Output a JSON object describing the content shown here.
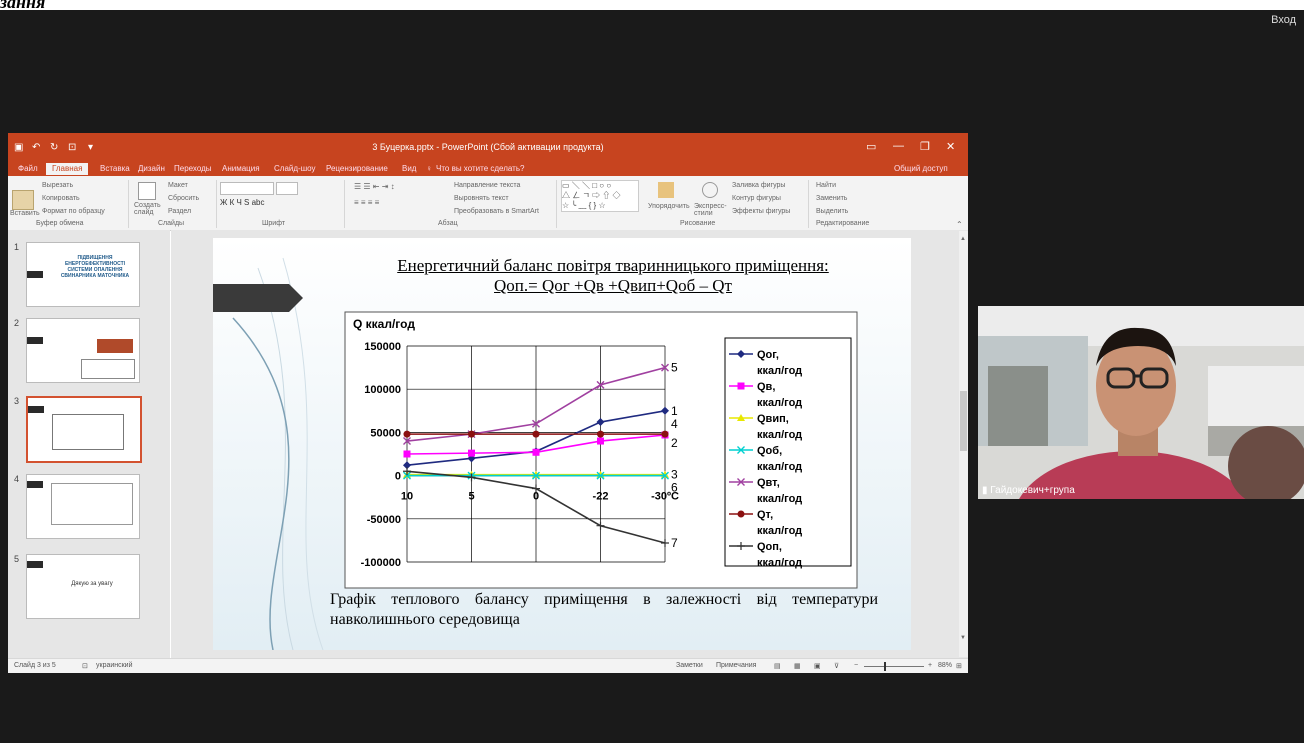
{
  "overlay": {
    "top_text": "зання",
    "login": "Вход"
  },
  "ppt": {
    "window_title": "3 Буцерка.pptx - PowerPoint (Сбой активации продукта)",
    "tabs": [
      "Файл",
      "Главная",
      "Вставка",
      "Дизайн",
      "Переходы",
      "Анимация",
      "Слайд-шоу",
      "Рецензирование",
      "Вид"
    ],
    "tell_me": "Что вы хотите сделать?",
    "share": "Общий доступ",
    "ribbon": {
      "paste": "Вставить",
      "cut": "Вырезать",
      "copy": "Копировать",
      "format_painter": "Формат по образцу",
      "clipboard": "Буфер обмена",
      "create_slide": "Создать слайд",
      "layout": "Макет",
      "reset": "Сбросить",
      "section": "Раздел",
      "slides": "Слайды",
      "font": "Шрифт",
      "paragraph": "Абзац",
      "text_direction": "Направление текста",
      "align_text": "Выровнять текст",
      "convert_smartart": "Преобразовать в SmartArt",
      "arrange": "Упорядочить",
      "quick_styles": "Экспресс-стили",
      "fill": "Заливка фигуры",
      "outline": "Контур фигуры",
      "effects": "Эффекты фигуры",
      "drawing": "Рисование",
      "find": "Найти",
      "replace": "Заменить",
      "select": "Выделить",
      "editing": "Редактирование"
    },
    "status": {
      "slide": "Слайд 3 из 5",
      "lang": "украинский",
      "notes": "Заметки",
      "comments": "Примечания",
      "zoom": "88%"
    }
  },
  "thumbnails": [
    {
      "num": "1",
      "title": "ПІДВИЩЕННЯ ЕНЕРГОЕФЕКТИВНОСТІ СИСТЕМИ ОПАЛЕННЯ СВИНАРНИКА МАТОЧНИКА",
      "selected": false
    },
    {
      "num": "2",
      "title": "",
      "selected": false
    },
    {
      "num": "3",
      "title": "",
      "selected": true
    },
    {
      "num": "4",
      "title": "",
      "selected": false
    },
    {
      "num": "5",
      "title": "Дякую за увагу",
      "selected": false
    }
  ],
  "slide": {
    "title_line1": "Енергетичний баланс повітря тваринницького приміщення:",
    "title_line2": "Qоп.= Qог +Qв +Qвип+Qоб – Qт",
    "caption": "Графік теплового балансу приміщення в залежності від температури навколишнього середовища"
  },
  "chart_data": {
    "type": "line",
    "ylabel": "Q ккал/год",
    "categories": [
      "10",
      "5",
      "0",
      "-22",
      "-30ºC"
    ],
    "ylim": [
      -100000,
      150000
    ],
    "yticks": [
      "150000",
      "100000",
      "50000",
      "0",
      "-50000",
      "-100000"
    ],
    "series": [
      {
        "name": "Qог, ккал/год",
        "values": [
          12000,
          20000,
          28000,
          62000,
          75000
        ],
        "color": "#1f2a80",
        "marker": "diamond",
        "label": "1"
      },
      {
        "name": "Qв, ккал/год",
        "values": [
          25000,
          26000,
          27000,
          40000,
          47000
        ],
        "color": "#ff00ff",
        "marker": "square",
        "label": "2"
      },
      {
        "name": "Qвип, ккал/год",
        "values": [
          1000,
          1000,
          1000,
          1000,
          1000
        ],
        "color": "#e8e800",
        "marker": "triangle",
        "label": "3"
      },
      {
        "name": "Qоб, ккал/год",
        "values": [
          0,
          0,
          0,
          0,
          0
        ],
        "color": "#00d0d0",
        "marker": "x",
        "label": "6"
      },
      {
        "name": "Qвт, ккал/год",
        "values": [
          40000,
          48000,
          60000,
          105000,
          125000
        ],
        "color": "#a040a0",
        "marker": "x",
        "label": "5"
      },
      {
        "name": "Qт, ккал/год",
        "values": [
          48000,
          48000,
          48000,
          48000,
          48000
        ],
        "color": "#8b1010",
        "marker": "circle",
        "label": "4"
      },
      {
        "name": "Qоп, ккал/год",
        "values": [
          5000,
          -2000,
          -15000,
          -58000,
          -78000
        ],
        "color": "#333333",
        "marker": "plus",
        "label": "7"
      }
    ]
  },
  "webcam": {
    "name": "Гайдокевич+група"
  }
}
